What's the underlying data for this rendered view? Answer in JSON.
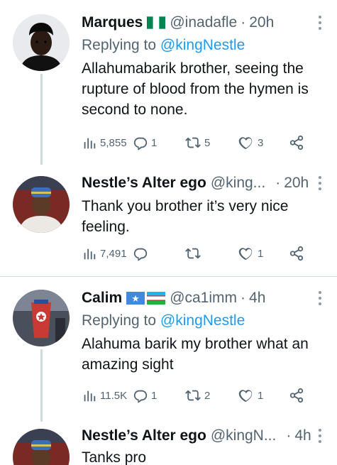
{
  "tweets": [
    {
      "name": "Marques",
      "flags": [
        "nigeria-flag"
      ],
      "handle": "@inadafle",
      "time": "20h",
      "replying_prefix": "Replying to",
      "replying_to": "@kingNestle",
      "text": "Allahumabarik brother, seeing the rupture of blood from the hymen is second to none.",
      "views": "5,855",
      "replies": "1",
      "retweets": "5",
      "likes": "3"
    },
    {
      "name": "Nestle’s Alter ego",
      "handle": "@king...",
      "time": "20h",
      "text": "Thank you brother it’s very nice feeling.",
      "views": "7,491",
      "replies": "",
      "retweets": "",
      "likes": "1"
    },
    {
      "name": "Calim",
      "flags": [
        "somalia-flag",
        "uzbekistan-flag"
      ],
      "handle": "@ca1imm",
      "time": "4h",
      "replying_prefix": "Replying to",
      "replying_to": "@kingNestle",
      "text": "Alahuma barik my brother what an amazing sight",
      "views": "11.5K",
      "replies": "1",
      "retweets": "2",
      "likes": "1"
    },
    {
      "name": "Nestle’s Alter ego",
      "handle": "@kingN...",
      "time": "4h",
      "text": "Tanks pro"
    }
  ],
  "colors": {
    "accent": "#1d9bf0",
    "secondary_text": "#536471",
    "primary_text": "#0f1419",
    "divider": "#cfd9de"
  },
  "icons": [
    "views-icon",
    "reply-icon",
    "retweet-icon",
    "like-icon",
    "share-icon",
    "more-options-icon"
  ]
}
